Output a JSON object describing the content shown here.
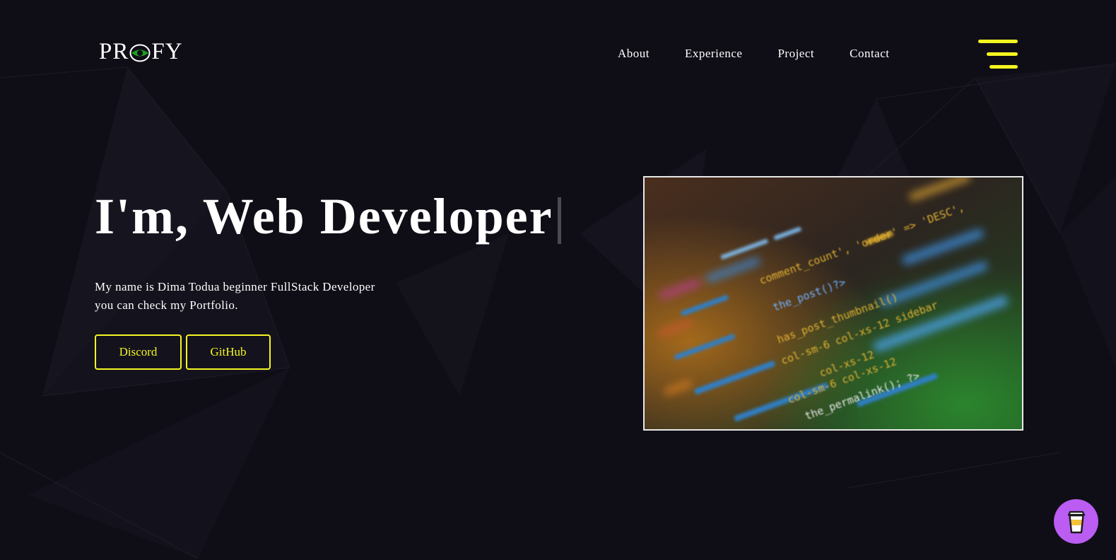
{
  "header": {
    "logo_left": "PR",
    "logo_right": "FY",
    "nav": [
      {
        "label": "About"
      },
      {
        "label": "Experience"
      },
      {
        "label": "Project"
      },
      {
        "label": "Contact"
      }
    ],
    "menu_icon": "hamburger-icon"
  },
  "hero": {
    "title": "I'm, Web Developer",
    "description_line1": "My name is Dima Todua beginner FullStack Developer",
    "description_line2": "you can check my Portfolio.",
    "buttons": {
      "discord": "Discord",
      "github": "GitHub"
    },
    "image_alt": "code-screen-image",
    "code_lines": [
      "comment_count', 'order' => 'DESC',",
      "the_post()?>",
      "has_post_thumbnail()",
      "col-sm-6 col-xs-12 sidebar",
      "col-xs-12",
      "col-sm-6 col-xs-12",
      "the_permalink(); ?>"
    ]
  },
  "floating": {
    "coffee_icon": "coffee-cup-icon"
  },
  "colors": {
    "background": "#0f0e17",
    "accent": "#f5f520",
    "coffee": "#bb5cf2",
    "logo_eye": "#1f9d1f"
  }
}
